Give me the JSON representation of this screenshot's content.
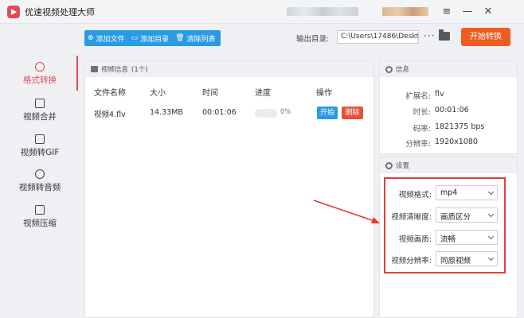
{
  "window": {
    "title": "优速视频处理大师"
  },
  "toolbar": {
    "add_file": "添加文件",
    "add_folder": "添加目录",
    "clear_list": "清除列表",
    "output_label": "输出目录:",
    "output_path": "C:\\Users\\17486\\Deskto",
    "more": "···",
    "start_all": "开始转换"
  },
  "sidebar": {
    "items": [
      {
        "label": "格式转换",
        "icon": "format-convert-icon"
      },
      {
        "label": "视频合并",
        "icon": "merge-icon"
      },
      {
        "label": "视频转GIF",
        "icon": "gif-icon"
      },
      {
        "label": "视频转音频",
        "icon": "audio-icon"
      },
      {
        "label": "视频压缩",
        "icon": "compress-icon"
      }
    ],
    "active_index": 0
  },
  "file_panel": {
    "header": "视频信息",
    "count": "(1个)",
    "columns": [
      "文件名称",
      "大小",
      "时间",
      "进度",
      "操作"
    ],
    "rows": [
      {
        "name": "视频4.flv",
        "size": "14.33MB",
        "time": "00:01:06",
        "progress": "0%",
        "progress_value": 0,
        "start": "开始",
        "delete": "删除"
      }
    ]
  },
  "info_panel": {
    "header": "信息",
    "fields": [
      {
        "key": "扩展名:",
        "value": "flv"
      },
      {
        "key": "时长:",
        "value": "00:01:06"
      },
      {
        "key": "码率:",
        "value": "1821375 bps"
      },
      {
        "key": "分辨率:",
        "value": "1920x1080"
      }
    ]
  },
  "settings_panel": {
    "header": "设置",
    "fields": [
      {
        "key": "视频格式:",
        "value": "mp4"
      },
      {
        "key": "视频清晰度:",
        "value": "画质区分"
      },
      {
        "key": "视频画质:",
        "value": "流畅"
      },
      {
        "key": "视频分辨率:",
        "value": "同原视频"
      }
    ]
  },
  "colors": {
    "accent_blue": "#2a9ae6",
    "accent_orange": "#f05c20",
    "active_red": "#e34a57",
    "delete_red": "#e8503a",
    "annotation_red": "#e53c32"
  }
}
